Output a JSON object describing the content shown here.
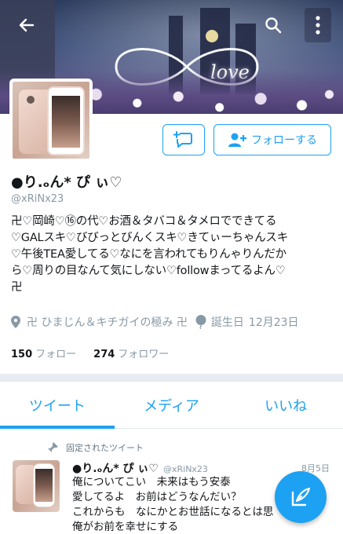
{
  "header": {
    "banner_text": "love",
    "colors": {
      "accent": "#1da1f2",
      "muted": "#8899a6"
    }
  },
  "actions": {
    "follow_label": "フォローする"
  },
  "profile": {
    "display_name": "●り.ₒん* ぴ ぃ♡",
    "handle": "@xRiNx23",
    "bio_lines": [
      "卍♡岡崎♡⑯の代♡お酒＆タバコ＆タメロでできてる",
      "♡GALスキ♡びびっとびんくスキ♡きてぃーちゃんスキ",
      "♡午後TEA愛してる♡なにを言われてもりんゃりんだか",
      "ら♡周りの目なんて気にしない♡followまってるよん♡",
      "卍"
    ],
    "location": "卍 ひまじん＆キチガイの極み 卍",
    "birthday_label": "誕生日",
    "birthday_value": "12月23日",
    "following_count": "150",
    "following_label": "フォロー",
    "followers_count": "274",
    "followers_label": "フォロワー"
  },
  "tabs": [
    {
      "label": "ツイート",
      "active": true
    },
    {
      "label": "メディア",
      "active": false
    },
    {
      "label": "いいね",
      "active": false
    }
  ],
  "tweet": {
    "pinned_label": "固定されたツイート",
    "name": "●り.ₒん* ぴ ぃ♡",
    "handle": "@xRiNx23",
    "date": "8月5日",
    "lines": [
      "俺についてこい　未来はもう安泰",
      "愛してるよ　お前はどうなんだい？",
      "これからも　なにかとお世話になるとは思",
      "俺がお前を幸せにする"
    ]
  },
  "icons": {
    "back": "arrow-left-icon",
    "search": "search-icon",
    "more": "more-vertical-icon",
    "message": "message-icon",
    "follow": "person-add-icon",
    "location": "location-pin-icon",
    "birthday": "balloon-icon",
    "pin": "pin-icon",
    "compose": "compose-icon"
  }
}
